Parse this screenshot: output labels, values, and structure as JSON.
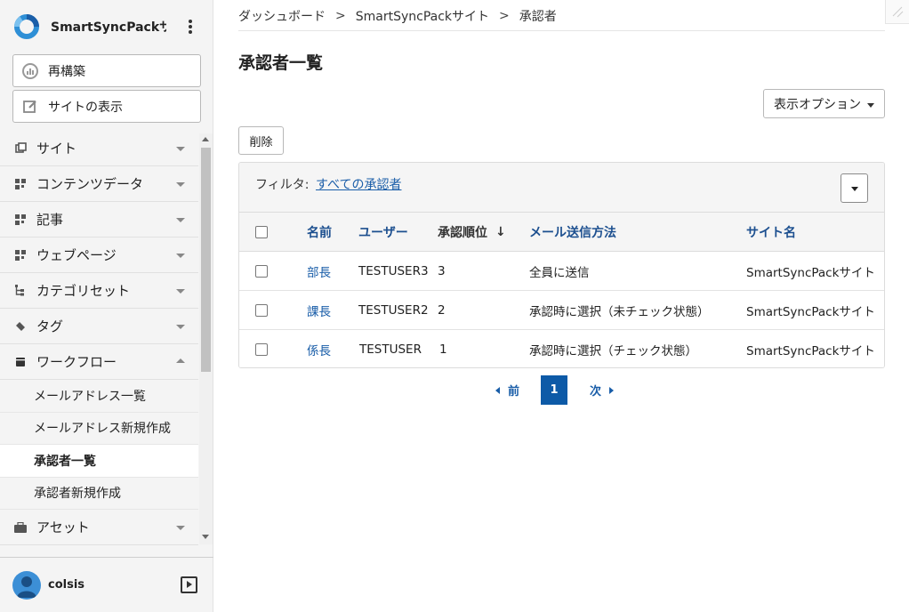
{
  "sidebar": {
    "site_name": "SmartSyncPackサ...",
    "rebuild_label": "再構築",
    "view_site_label": "サイトの表示",
    "nav": [
      {
        "label": "サイト",
        "icon": "copy-icon"
      },
      {
        "label": "コンテンツデータ",
        "icon": "grid-icon"
      },
      {
        "label": "記事",
        "icon": "grid-icon"
      },
      {
        "label": "ウェブページ",
        "icon": "grid-icon"
      },
      {
        "label": "カテゴリセット",
        "icon": "tree-icon"
      },
      {
        "label": "タグ",
        "icon": "tag-icon"
      },
      {
        "label": "ワークフロー",
        "icon": "workflow-icon",
        "expanded": true
      }
    ],
    "sub_items": [
      {
        "label": "メールアドレス一覧",
        "active": false
      },
      {
        "label": "メールアドレス新規作成",
        "active": false
      },
      {
        "label": "承認者一覧",
        "active": true
      },
      {
        "label": "承認者新規作成",
        "active": false
      }
    ],
    "asset_label": "アセット",
    "user_name": "colsis"
  },
  "breadcrumb": [
    "ダッシュボード",
    "SmartSyncPackサイト",
    "承認者"
  ],
  "breadcrumb_sep": ">",
  "page_title": "承認者一覧",
  "display_options_label": "表示オプション",
  "delete_label": "削除",
  "filter": {
    "label": "フィルタ:",
    "value": "すべての承認者"
  },
  "table": {
    "headers": {
      "name": "名前",
      "user": "ユーザー",
      "order": "承認順位",
      "sort_arrow": "↓",
      "mail": "メール送信方法",
      "site": "サイト名"
    },
    "rows": [
      {
        "name": "部長",
        "user": "TESTUSER3",
        "order": "3",
        "mail": "全員に送信",
        "site": "SmartSyncPackサイト"
      },
      {
        "name": "課長",
        "user": "TESTUSER2",
        "order": "2",
        "mail": "承認時に選択（未チェック状態）",
        "site": "SmartSyncPackサイト"
      },
      {
        "name": "係長",
        "user": "TESTUSER",
        "order": "1",
        "mail": "承認時に選択（チェック状態）",
        "site": "SmartSyncPackサイト"
      }
    ]
  },
  "pagination": {
    "prev": "前",
    "current": "1",
    "next": "次"
  },
  "colors": {
    "accent": "#0d5aa7",
    "link": "#195da8",
    "logo": "#2e8fd6"
  }
}
